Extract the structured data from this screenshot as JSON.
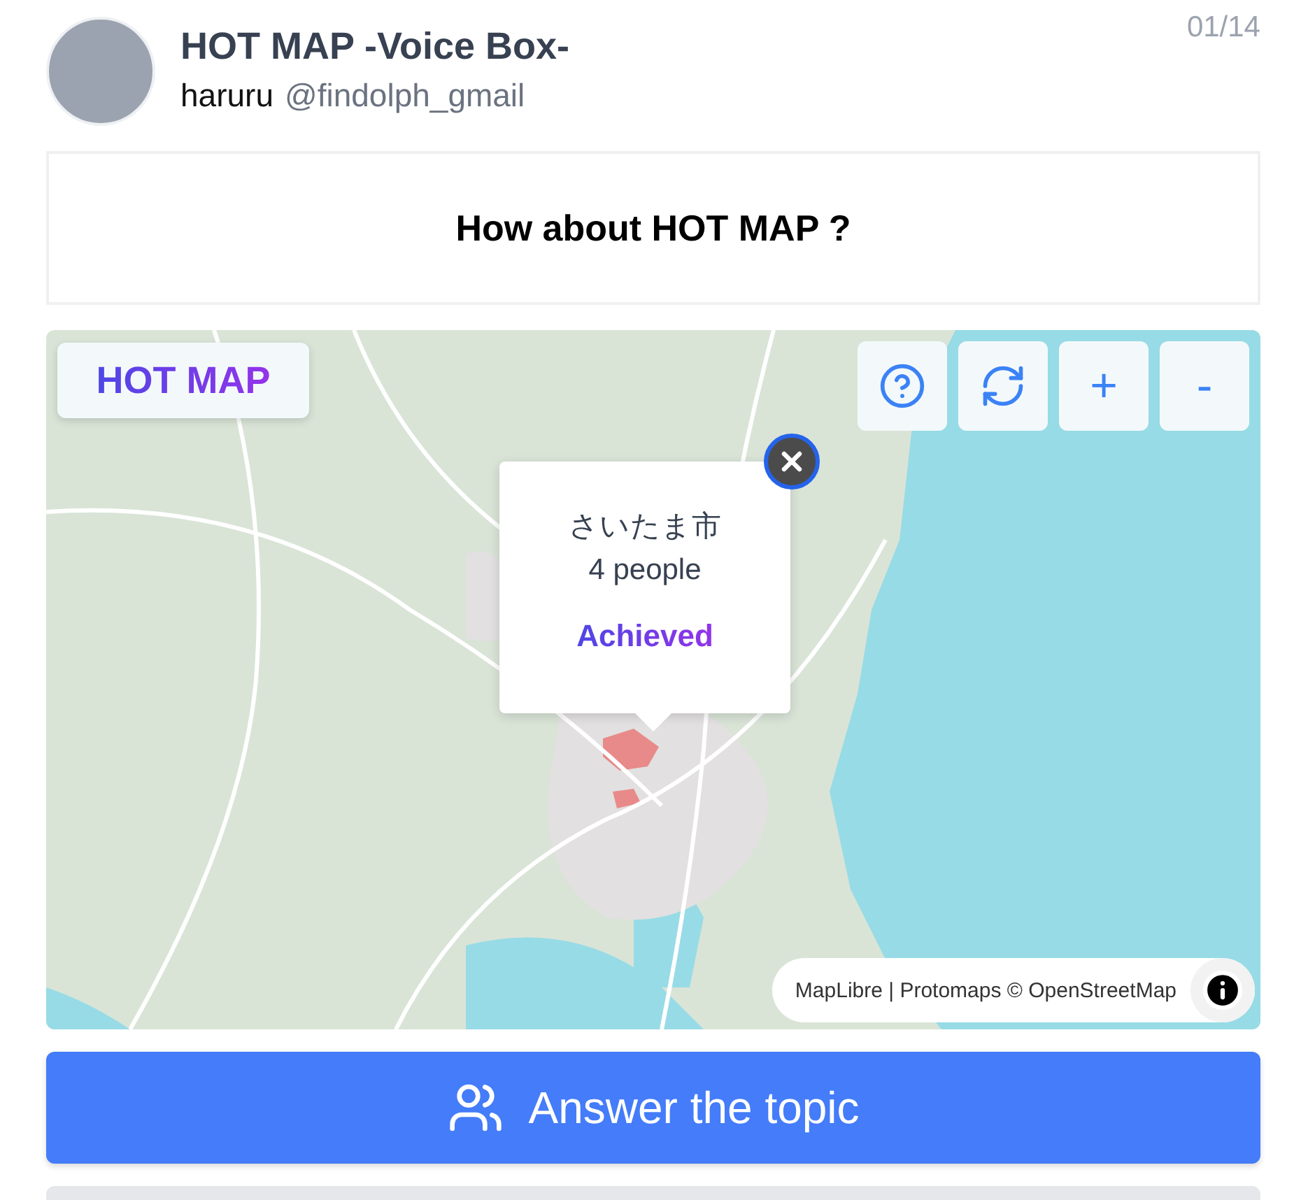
{
  "header": {
    "title": "HOT MAP -Voice Box-",
    "user_name": "haruru",
    "user_handle": "@findolph_gmail",
    "counter": "01/14"
  },
  "question": "How about HOT MAP ?",
  "map": {
    "badge": "HOT MAP",
    "controls": [
      {
        "kind": "help"
      },
      {
        "kind": "refresh"
      },
      {
        "kind": "zoom-in",
        "label": "+"
      },
      {
        "kind": "zoom-out",
        "label": "-"
      }
    ],
    "popup": {
      "city": "さいたま市",
      "people": "4 people",
      "status": "Achieved"
    },
    "attribution": "MapLibre | Protomaps © OpenStreetMap"
  },
  "answer_button": "Answer the topic"
}
